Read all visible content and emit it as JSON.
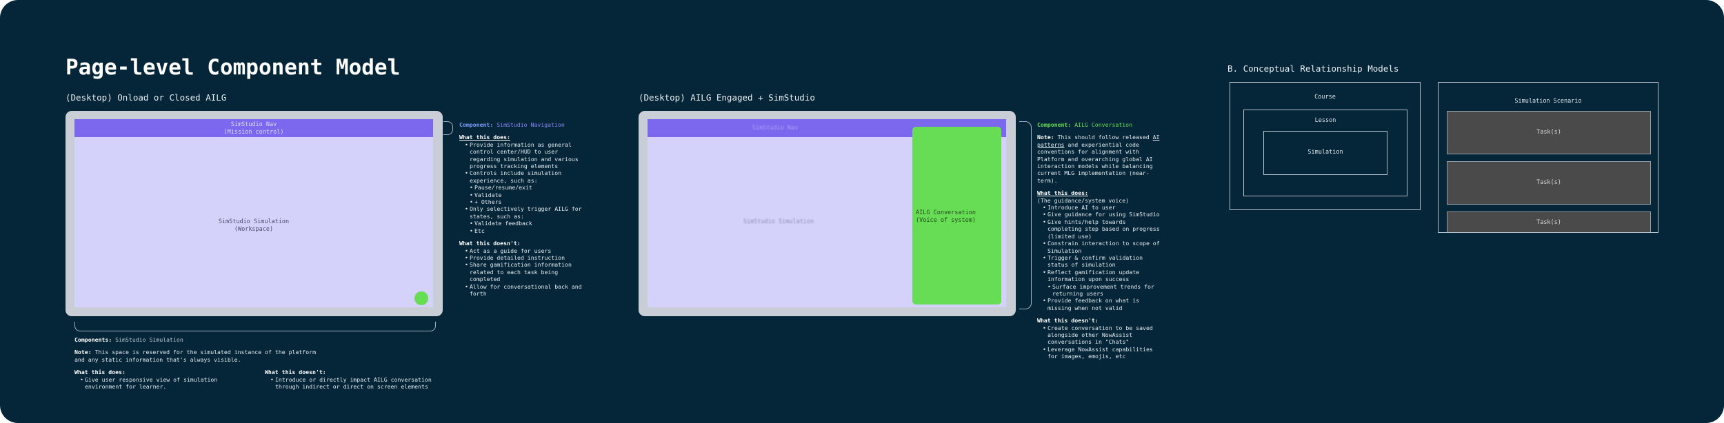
{
  "title": "Page-level Component Model",
  "left": {
    "subtitle": "(Desktop) Onload or Closed AILG",
    "nav_label": "SimStudio Nav",
    "nav_sub": "(Mission control)",
    "workspace_label": "SimStudio Simulation",
    "workspace_sub": "(Workspace)",
    "nav_annotation": {
      "component_prefix": "Component:",
      "component_name": "SimStudio Navigation",
      "does_heading": "What this does:",
      "does": [
        "Provide information as general control center/HUD to user regarding simulation and various progress tracking elements",
        "Controls include simulation experience, such as:"
      ],
      "controls": [
        "Pause/resume/exit",
        "Validate",
        "+ Others"
      ],
      "does_more": "Only selectively trigger AILG for states, such as:",
      "states": [
        "Validate feedback",
        "Etc"
      ],
      "doesnt_heading": "What this doesn't:",
      "doesnt": [
        "Act as a guide for users",
        "Provide detailed instruction",
        "Share gamification information related to each task being completed",
        "Allow for conversational back and forth"
      ]
    },
    "sim_annotation": {
      "component_prefix": "Components:",
      "component_name": "SimStudio Simulation",
      "note_prefix": "Note:",
      "note": "This space is reserved for the simulated instance of the platform and any static information that's always visible.",
      "does_heading": "What this does:",
      "does": [
        "Give user responsive view of simulation environment for learner."
      ],
      "doesnt_heading": "What this doesn't:",
      "doesnt": [
        "Introduce or directly impact AILG conversation through indirect or direct on screen elements"
      ]
    }
  },
  "middle": {
    "subtitle": "(Desktop) AILG Engaged + SimStudio",
    "nav_label": "SimStudio Nav",
    "workspace_label": "SimStudio Simulation",
    "panel_label": "AILG Conversation",
    "panel_sub": "(Voice of system)",
    "annotation": {
      "component_prefix": "Component:",
      "component_name": "AILG Conversation",
      "note_prefix": "Note:",
      "note_a": "This should follow released ",
      "note_link": "AI patterns",
      "note_b": " and experiential code conventions for alignment with Platform and overarching global AI interaction models while balancing current MLG implementation (near-term).",
      "does_heading": "What this does:",
      "does_sub": "(The guidance/system voice)",
      "does": [
        "Introduce AI to user",
        "Give guidance for using SimStudio",
        "Give hints/help towards completing step based on progress (limited use)",
        "Constrain interaction to scope of Simulation",
        "Trigger & confirm validation status of simulation",
        "Reflect gamification update information upon success"
      ],
      "does_nested": "Surface improvement trends for returning users",
      "does_last": "Provide feedback on what is missing when not valid",
      "doesnt_heading": "What this doesn't:",
      "doesnt": [
        "Create conversation to be saved alongside other NowAssist conversations in \"Chats\"",
        "Leverage NowAssist capabilities for images, emojis, etc"
      ]
    }
  },
  "right": {
    "heading": "B. Conceptual Relationship Models",
    "course": "Course",
    "lesson": "Lesson",
    "simulation": "Simulation",
    "scenario": "Simulation Scenario",
    "tasks": [
      "Task(s)",
      "Task(s)",
      "Task(s)"
    ]
  },
  "colors": {
    "background": "#052638",
    "nav": "#7b68ee",
    "screen": "#d4d1fb",
    "ailg_panel": "#66dd55",
    "status_dot": "#66dd55"
  }
}
